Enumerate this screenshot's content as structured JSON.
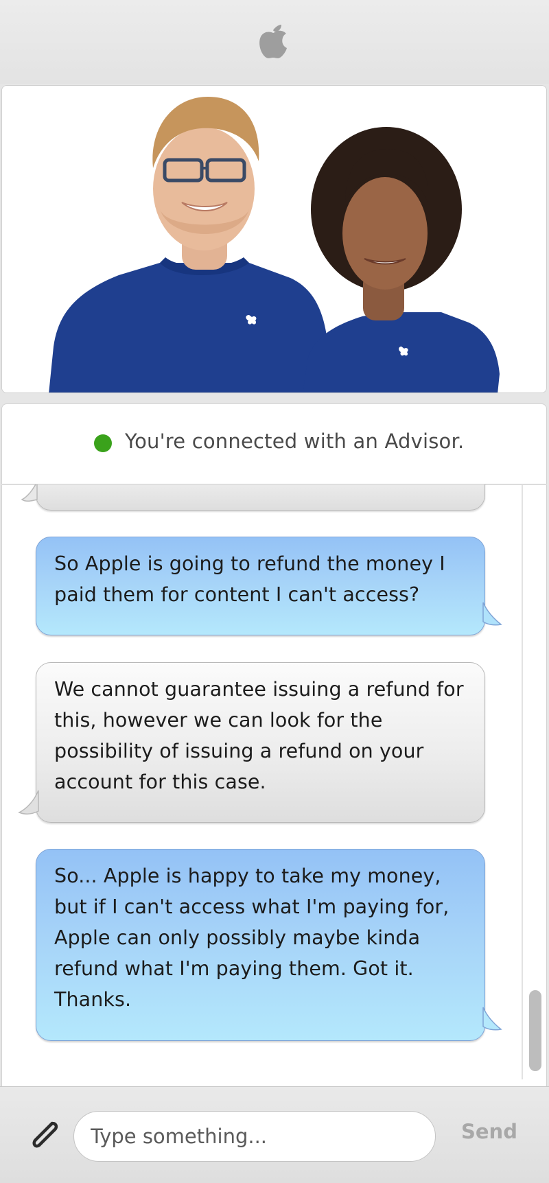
{
  "header": {
    "logo_icon": "apple-logo-icon"
  },
  "status": {
    "text": "You're connected with an Advisor.",
    "color": "#3aa21b"
  },
  "messages": [
    {
      "sender": "advisor",
      "text": ""
    },
    {
      "sender": "user",
      "lines": [
        "So Apple is going to refund the money I",
        "paid them for content I can't access?"
      ]
    },
    {
      "sender": "advisor",
      "lines": [
        "We cannot guarantee issuing a refund for",
        "this, however we can look for the",
        "possibility of issuing a refund on your",
        "account for this case."
      ]
    },
    {
      "sender": "user",
      "lines": [
        "So... Apple is happy to take my money,",
        "but if I can't access what I'm paying for,",
        "Apple can only possibly maybe kinda",
        "refund what I'm paying them. Got it.",
        "Thanks."
      ]
    }
  ],
  "input": {
    "placeholder": "Type something...",
    "send_label": "Send",
    "attach_icon": "paperclip-icon"
  },
  "colors": {
    "user_bubble": "#a6d3f8",
    "advisor_bubble": "#ececec",
    "status_dot": "#3aa21b"
  }
}
